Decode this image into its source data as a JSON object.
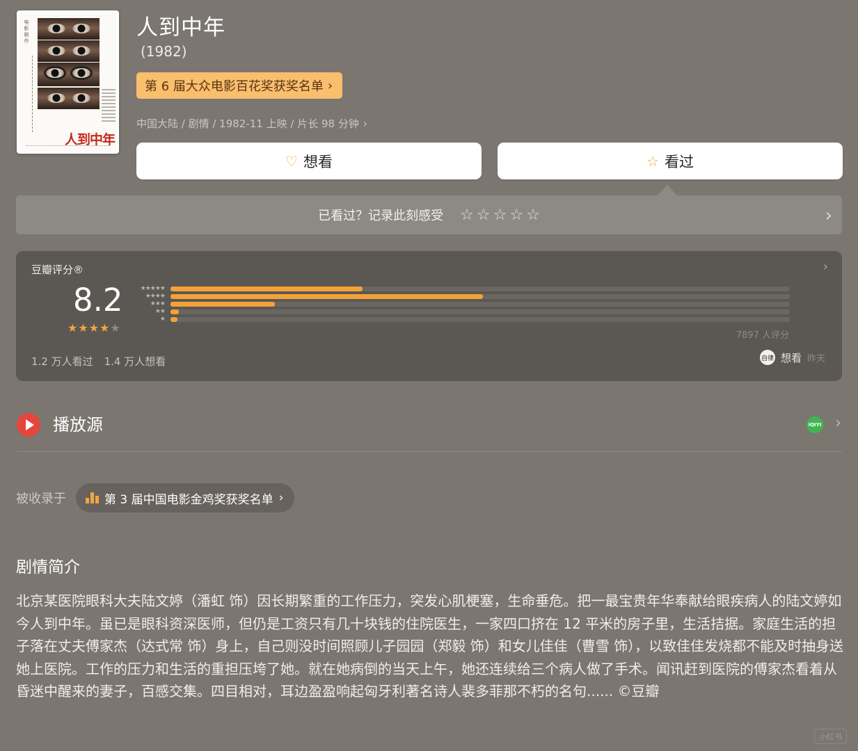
{
  "movie": {
    "poster_title": "人到中年",
    "poster_side_text": "电影剧作",
    "title": "人到中年",
    "year": "(1982)",
    "award_badge": "第 6 届大众电影百花奖获奖名单",
    "meta": "中国大陆 / 剧情 / 1982-11 上映 / 片长 98 分钟"
  },
  "actions": {
    "want_label": "想看",
    "seen_label": "看过"
  },
  "record": {
    "prompt": "已看过？记录此刻感受"
  },
  "rating": {
    "label": "豆瓣评分®",
    "score": "8.2",
    "stars_filled": 4,
    "distribution": [
      {
        "stars": "★★★★★",
        "fraction": 0.31
      },
      {
        "stars": "★★★★",
        "fraction": 0.505
      },
      {
        "stars": "★★★",
        "fraction": 0.168
      },
      {
        "stars": "★★",
        "fraction": 0.014
      },
      {
        "stars": "★",
        "fraction": 0.01
      }
    ],
    "count": "7897 人评分",
    "seen_count": "1.2 万人看过",
    "want_count": "1.4 万人想看",
    "friend_avatar_text": "自律",
    "friend_action": "想看",
    "friend_time": "昨天"
  },
  "play": {
    "title": "播放源",
    "source_icon_text": "iQIYI"
  },
  "collected": {
    "label": "被收录于",
    "list_name": "第 3 届中国电影金鸡奖获奖名单"
  },
  "synopsis": {
    "title": "剧情简介",
    "text": "北京某医院眼科大夫陆文婷（潘虹 饰）因长期繁重的工作压力，突发心肌梗塞，生命垂危。把一最宝贵年华奉献给眼疾病人的陆文婷如今人到中年。虽已是眼科资深医师，但仍是工资只有几十块钱的住院医生，一家四口挤在 12 平米的房子里，生活拮据。家庭生活的担子落在丈夫傅家杰（达式常 饰）身上，自己则没时间照顾儿子园园（郑毅 饰）和女儿佳佳（曹雪 饰），以致佳佳发烧都不能及时抽身送她上医院。工作的压力和生活的重担压垮了她。就在她病倒的当天上午，她还连续给三个病人做了手术。闻讯赶到医院的傅家杰看着从昏迷中醒来的妻子，百感交集。四目相对，耳边盈盈响起匈牙利著名诗人裴多菲那不朽的名句...... ©豆瓣"
  },
  "watermark": "小红书",
  "colors": {
    "background": "#7b7670",
    "accent": "#f4a238",
    "badge": "#f9be6e"
  }
}
